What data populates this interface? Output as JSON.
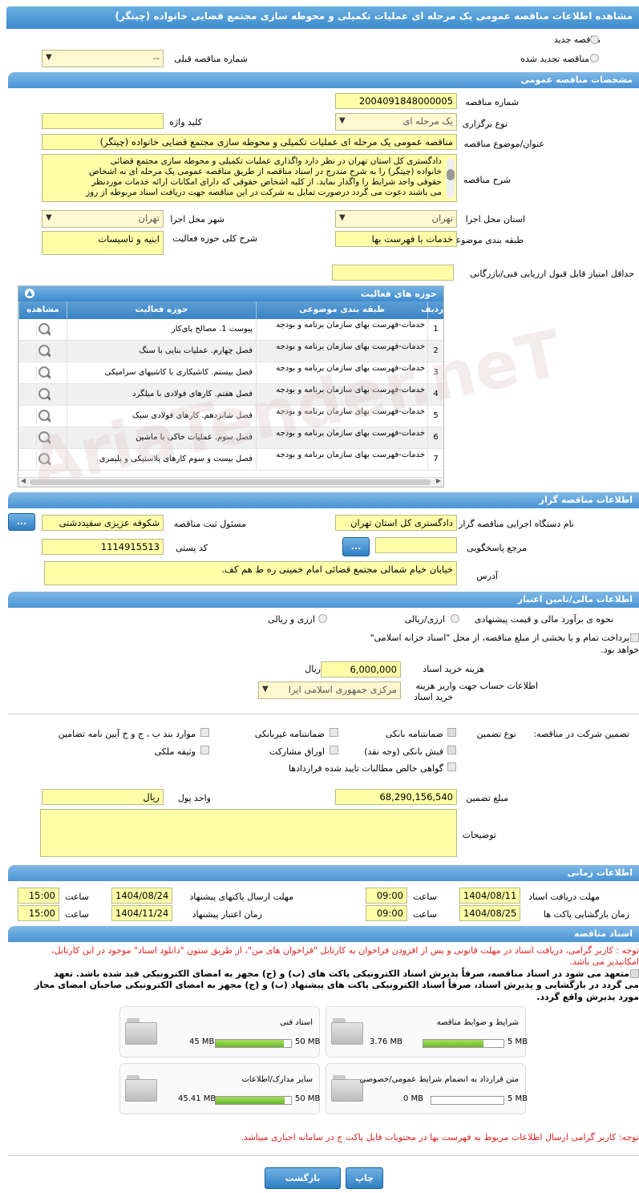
{
  "page": {
    "title": "مشاهده اطلاعات مناقصه عمومی یک مرحله ای عملیات تکمیلی و محوطه سازی مجتمع قضایی خانواده (چیتگر)"
  },
  "top": {
    "new_label": "مناقصه جدید",
    "renewed_label": "مناقصه تجدید شده",
    "prev_number_label": "شماره مناقصه قبلی",
    "prev_number_value": "--"
  },
  "general": {
    "header": "مشخصات مناقصه عمومی",
    "number_label": "شماره مناقصه",
    "number_value": "2004091848000005",
    "type_label": "نوع برگزاری",
    "type_value": "یک مرحله ای",
    "keyword_label": "کلید واژه",
    "keyword_value": "",
    "subject_label": "عنوان/موضوع مناقصه",
    "subject_value": "مناقصه عمومی یک مرحله ای عملیات تکمیلی و محوطه سازی مجتمع قضایی خانواده (چیتگر)",
    "desc_label": "شرح مناقصه",
    "desc_lines": [
      "دادگستری کل استان تهران در نظر دارد واگذاری عملیات تکمیلی و محوطه سازی مجتمع قضائی",
      "خانواده (چیتگر) را به شرح مندرج در اسناد مناقصه از طریق مناقصه عمومی یک مرحله ای به اشخاص",
      "حقوقی واجد شرایط را واگذار نماید. از کلیه اشخاص حقوقی که دارای امکانات ارائه خدمات موردنظر",
      "می باشند دعوت می گردد درصورت تمایل به شرکت در این مناقصه جهت دریافت اسناد مربوطه از روز"
    ],
    "province_label": "استان محل اجرا",
    "province_value": "تهران",
    "city_label": "شهر محل اجرا",
    "city_value": "تهران",
    "category_label": "طبقه بندی موضوعی",
    "category_value": "خدمات با فهرست بها",
    "scope_label": "شرح کلی حوزه فعالیت",
    "scope_value": "ابنیه و تاسیسات",
    "minscore_label": "حداقل امتیاز قابل قبول ارزیابی فنی/بازرگانی",
    "minscore_value": ""
  },
  "activity": {
    "title": "حوزه های فعالیت",
    "col_row": "ردیف",
    "col_category": "طبقه بندی موضوعی",
    "col_scope": "حوزه فعالیت",
    "col_view": "مشاهده",
    "rows": [
      {
        "n": "1",
        "cat": "خدمات-فهرست بهای سازمان برنامه و بودجه",
        "scope": "پیوست 1. مصالح پای‌کار"
      },
      {
        "n": "2",
        "cat": "خدمات-فهرست بهای سازمان برنامه و بودجه",
        "scope": "فصل چهارم. عملیات بنایی با سنگ"
      },
      {
        "n": "3",
        "cat": "خدمات-فهرست بهای سازمان برنامه و بودجه",
        "scope": "فصل بیستم. کاشیکاری با کاشیهای سرامیکی"
      },
      {
        "n": "4",
        "cat": "خدمات-فهرست بهای سازمان برنامه و بودجه",
        "scope": "فصل هفتم. کارهای فولادی با میلگرد"
      },
      {
        "n": "5",
        "cat": "خدمات-فهرست بهای سازمان برنامه و بودجه",
        "scope": "فصل شانزدهم. کارهای فولادی سبک"
      },
      {
        "n": "6",
        "cat": "خدمات-فهرست بهای سازمان برنامه و بودجه",
        "scope": "فصل سوم. عملیات خاکی با ماشین"
      },
      {
        "n": "7",
        "cat": "خدمات-فهرست بهای سازمان برنامه و بودجه",
        "scope": "فصل بیست و سوم کارهای پلاستیکی و پلیمری"
      }
    ]
  },
  "organizer": {
    "header": "اطلاعات مناقصه گزار",
    "org_label": "نام دستگاه اجرایی مناقصه گزار",
    "org_value": "دادگستری کل استان تهران",
    "resp_label": "مسئول ثبت مناقصه",
    "resp_value": "شکوفه عزیزی سفیددشتی",
    "ref_label": "مرجع پاسخگویی",
    "ref_value": "",
    "postal_label": "کد پستی",
    "postal_value": "1114915513",
    "address_label": "آدرس",
    "address_value": "خیابان خیام شمالی مجتمع قضائی امام خمینی ره ط هم کف.",
    "dots": "..."
  },
  "finance": {
    "header": "اطلاعات مالی/تامین اعتبار",
    "estimate_label": "نحوه ی برآورد مالی و قیمت پیشنهادی",
    "opt_currency": "ارزی/ریالی",
    "opt_currency2": "ارزی و ریالی",
    "treasury_line1": "پرداخت تمام و یا بخشی از مبلغ مناقصه، از محل \"اسناد خزانه اسلامی\"",
    "treasury_line2": "خواهد بود.",
    "fee_label": "هزینه خرید اسناد",
    "fee_value": "6,000,000",
    "fee_unit": "ریال",
    "account_label1": "اطلاعات حساب جهت واریز هزینه",
    "account_label2": "خرید اسناد",
    "account_value": "مرکزی جمهوری اسلامی ایرا"
  },
  "guarantee": {
    "label": "تضمین شرکت در مناقصه:",
    "type_label": "نوع تضمین",
    "bank": "ضمانتنامه بانکی",
    "nonbank": "ضمانتنامه غیربانکی",
    "items_bcd": "موارد بند ب ، ج و خ آیین نامه تضامین",
    "receipt": "فیش بانکی (وجه نقد)",
    "bonds": "اوراق مشارکت",
    "property": "وثیقه ملکی",
    "cert": "گواهی خالص مطالبات تایید شده قراردادها",
    "amount_label": "مبلغ تضمین",
    "amount_value": "68,290,156,540",
    "currency_label": "واحد پول",
    "currency_value": "ریال",
    "notes_label": "توضیحات"
  },
  "timing": {
    "header": "اطلاعات زمانی",
    "recv_label": "مهلت دریافت اسناد",
    "recv_date": "1404/08/11",
    "recv_time": "09:00",
    "send_label": "مهلت ارسال پاکتهای پیشنهاد",
    "send_date": "1404/08/24",
    "send_time": "15:00",
    "open_label": "زمان بازگشایی پاکت ها",
    "open_date": "1404/08/25",
    "open_time": "09:00",
    "valid_label": "زمان اعتبار پیشنهاد",
    "valid_date": "1404/11/24",
    "valid_time": "15:00",
    "time_label": "ساعت"
  },
  "docs": {
    "header": "اسناد مناقصه",
    "note1": "توجه : کاربر گرامی، دریافت اسناد در مهلت قانونی و پس از افزودن فراخوان به کارتابل \"فراخوان های من\"، از طریق ستون \"دانلود اسناد\" موجود در این کارتابل،",
    "note2": "امکانپذیر می باشد.",
    "commit1": "متعهد می شود در اسناد مناقصه، صرفاً پذیرش اسناد الکترونیکی پاکت های (ب) و (ج) مجهز به امضای الکترونیکی قید شده باشد. تعهد",
    "commit2": "می گردد در بازگشایی و پذیرش اسناد، صرفاً اسناد الکترونیکی پاکت های پیشنهاد (ب) و (ج) مجهز به امضای الکترونیکی صاحبان امضای مجاز",
    "commit3": "مورد پذیرش واقع گردد.",
    "files": [
      {
        "name": "شرایط و ضوابط مناقصه",
        "used": "3.76 MB",
        "max": "5 MB",
        "pct": 0.75
      },
      {
        "name": "اسناد فنی",
        "used": "45 MB",
        "max": "50 MB",
        "pct": 0.9
      },
      {
        "name": "متن قرارداد به انضمام شرایط عمومی/خصوصی",
        "used": "0 MB",
        "max": "5 MB",
        "pct": 0
      },
      {
        "name": "سایر مدارک/اطلاعات",
        "used": "45.41 MB",
        "max": "50 MB",
        "pct": 0.91
      }
    ],
    "note3": "توجه: کاربر گرامی ارسال اطلاعات مربوط به فهرست بها در محتویات فایل پاکت ج در سامانه اجباری میباشد."
  },
  "actions": {
    "back": "بازگشت",
    "print": "چاپ"
  },
  "watermark": "AriaTender.neT"
}
